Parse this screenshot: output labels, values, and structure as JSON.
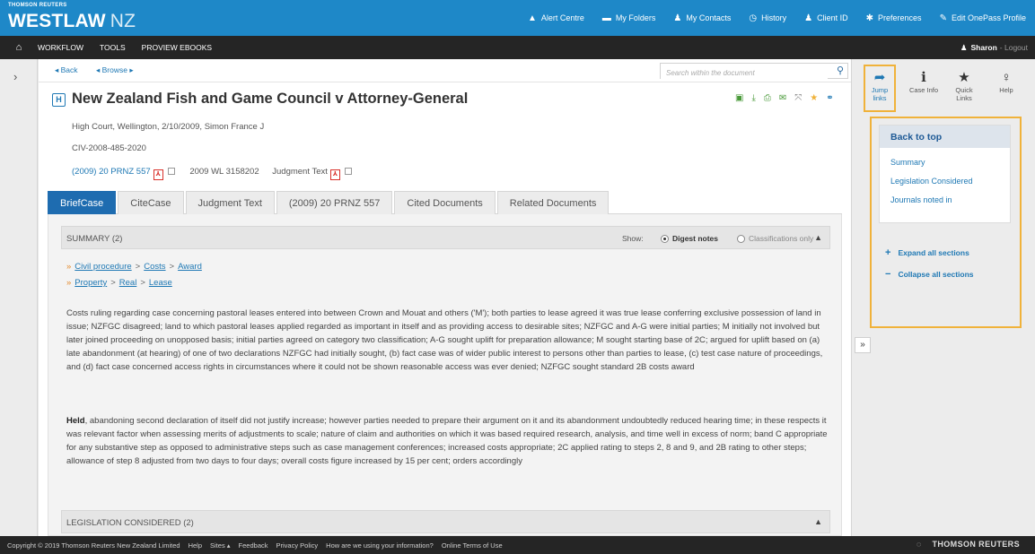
{
  "brand": {
    "small": "THOMSON REUTERS",
    "name": "WESTLAW",
    "region": "NZ"
  },
  "topnav": [
    {
      "icon": "▲",
      "label": "Alert Centre"
    },
    {
      "icon": "▬",
      "label": "My Folders"
    },
    {
      "icon": "♟",
      "label": "My Contacts"
    },
    {
      "icon": "◷",
      "label": "History"
    },
    {
      "icon": "♟",
      "label": "Client ID"
    },
    {
      "icon": "✱",
      "label": "Preferences"
    },
    {
      "icon": "✎",
      "label": "Edit OnePass Profile"
    }
  ],
  "darknav": {
    "items": [
      "WORKFLOW",
      "TOOLS",
      "PROVIEW EBOOKS"
    ],
    "user": "Sharon",
    "logout": "- Logout"
  },
  "docbar": {
    "back": "◂ Back",
    "browse": "◂ Browse ▸",
    "search_placeholder": "Search within the document"
  },
  "document": {
    "badge": "H",
    "title": "New Zealand Fish and Game Council v Attorney-General",
    "court": "High Court, Wellington, 2/10/2009, Simon France J",
    "file_no": "CIV-2008-485-2020",
    "citation1": "(2009) 20 PRNZ 557",
    "citation2": "2009 WL 3158202",
    "judgment": "Judgment Text"
  },
  "tabs": [
    "BriefCase",
    "CiteCase",
    "Judgment Text",
    "(2009) 20 PRNZ 557",
    "Cited Documents",
    "Related Documents"
  ],
  "summary": {
    "header": "SUMMARY (2)",
    "show": "Show:",
    "digest": "Digest notes",
    "classifications": "Classifications only",
    "crumbs1": [
      "Civil procedure",
      "Costs",
      "Award"
    ],
    "crumbs2": [
      "Property",
      "Real",
      "Lease"
    ],
    "para1": "Costs ruling regarding case concerning pastoral leases entered into between Crown and Mouat and others ('M'); both parties to lease agreed it was true lease conferring exclusive possession of land in issue; NZFGC disagreed; land to which pastoral leases applied regarded as important in itself and as providing access to desirable sites; NZFGC and A-G were initial parties; M initially not involved but later joined proceeding on unopposed basis; initial parties agreed on category two classification; A-G sought uplift for preparation allowance; M sought starting base of 2C; argued for uplift based on (a) late abandonment (at hearing) of one of two declarations NZFGC had initially sought, (b) fact case was of wider public interest to persons other than parties to lease, (c) test case nature of proceedings, and (d) fact case concerned access rights in circumstances where it could not be shown reasonable access was ever denied; NZFGC sought standard 2B costs award",
    "held_label": "Held",
    "para2": ", abandoning second declaration of itself did not justify increase; however parties needed to prepare their argument on it and its abandonment undoubtedly reduced hearing time; in these respects it was relevant factor when assessing merits of adjustments to scale; nature of claim and authorities on which it was based required research, analysis, and time well in excess of norm; band C appropriate for any substantive step as opposed to administrative steps such as case management conferences; increased costs appropriate; 2C applied rating to steps 2, 8 and 9, and 2B rating to other steps; allowance of step 8 adjusted from two days to four days; overall costs figure increased by 15 per cent; orders accordingly"
  },
  "legislation": {
    "header": "LEGISLATION CONSIDERED (2)"
  },
  "rightpanel": {
    "jump": "Jump links",
    "caseinfo": "Case Info",
    "quicklinks": "Quick Links",
    "help": "Help",
    "toc_head": "Back to top",
    "toc_links": [
      "Summary",
      "Legislation Considered",
      "Journals noted in"
    ],
    "expand": "Expand all sections",
    "collapse": "Collapse all sections"
  },
  "footer": {
    "items": [
      "Copyright © 2019 Thomson Reuters New Zealand Limited",
      "Help",
      "Sites ▴",
      "Feedback",
      "Privacy Policy",
      "How are we using your information?",
      "Online Terms of Use"
    ],
    "logo": "THOMSON REUTERS"
  }
}
